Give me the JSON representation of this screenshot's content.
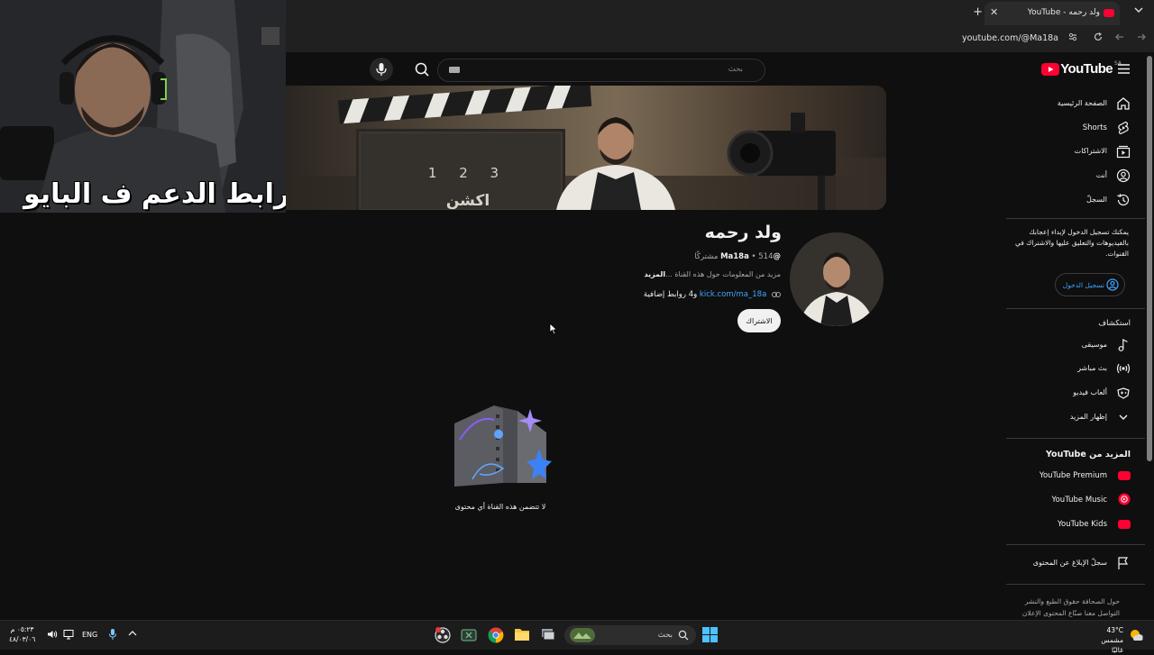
{
  "browser": {
    "tab_title": "ولد رحمه - YouTube",
    "url": "youtube.com/@Ma18a"
  },
  "overlay": {
    "bio_text": "رابط الدعم ف البايو"
  },
  "masthead": {
    "search_placeholder": "بحث",
    "logo_text": "YouTube",
    "region": "SA"
  },
  "banner": {
    "clapper_numbers": "1 2 3",
    "clapper_word": "اكشن"
  },
  "channel": {
    "name": "ولد رحمه",
    "handle": "@Ma18a",
    "subscribers": "514 مشتركًا",
    "description_prefix": "مزيد من المعلومات حول هذه القناة ...",
    "description_more": "المزيد",
    "link_url": "kick.com/ma_18a",
    "link_extra": "و4 روابط إضافية",
    "subscribe_label": "الاشتراك",
    "empty_message": "لا تتضمن هذه القناة أي محتوى"
  },
  "sidebar": {
    "main": [
      {
        "label": "الصفحة الرئيسية",
        "icon": "home-icon"
      },
      {
        "label": "Shorts",
        "icon": "shorts-icon"
      },
      {
        "label": "الاشتراكات",
        "icon": "subscriptions-icon"
      },
      {
        "label": "أنت",
        "icon": "you-icon"
      },
      {
        "label": "السجلّ",
        "icon": "history-icon"
      }
    ],
    "signin_prompt": "يمكنك تسجيل الدخول لإبداء إعجابك بالفيديوهات والتعليق عليها والاشتراك في القنوات.",
    "signin_label": "تسجيل الدخول",
    "explore_title": "استكشاف",
    "explore": [
      {
        "label": "موسيقى",
        "icon": "music-icon"
      },
      {
        "label": "بث مباشر",
        "icon": "live-icon"
      },
      {
        "label": "ألعاب فيديو",
        "icon": "gaming-icon"
      },
      {
        "label": "إظهار المزيد",
        "icon": "chevron-down-icon"
      }
    ],
    "more_title": "المزيد من YouTube",
    "more": [
      {
        "label": "YouTube Premium",
        "icon": "youtube-premium-icon"
      },
      {
        "label": "YouTube Music",
        "icon": "youtube-music-icon"
      },
      {
        "label": "YouTube Kids",
        "icon": "youtube-kids-icon"
      }
    ],
    "report_label": "سجلّ الإبلاغ عن المحتوى",
    "footer_line1": "حول  الصحافة  حقوق الطبع والنشر",
    "footer_line2": "التواصل معنا  صنّاع المحتوى  الإعلان"
  },
  "taskbar": {
    "search_label": "بحث",
    "lang": "ENG",
    "time": "٠٥:٢٣ م",
    "date": "٤٨/٠٣/٠٦",
    "temperature": "43°C",
    "weather": "مشمس غالبًا"
  },
  "colors": {
    "yt_red": "#ff0033",
    "link_blue": "#3ea6ff",
    "background": "#0f0f0f"
  }
}
